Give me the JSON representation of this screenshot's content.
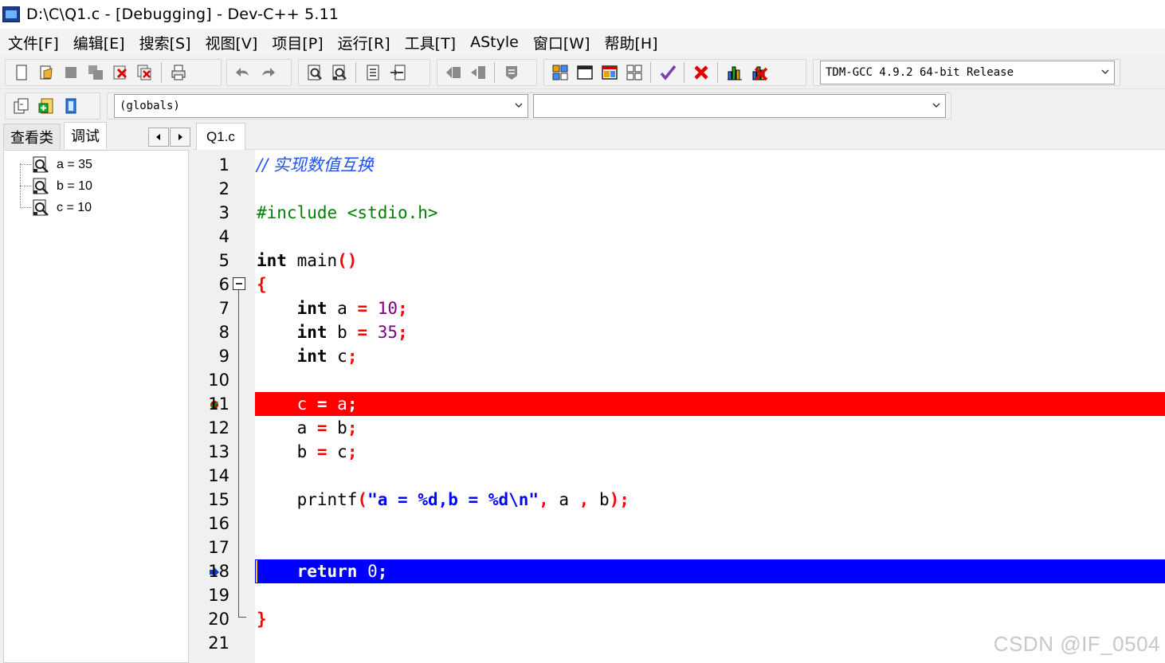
{
  "window": {
    "title": "D:\\C\\Q1.c - [Debugging] - Dev-C++ 5.11"
  },
  "menu": [
    "文件[F]",
    "编辑[E]",
    "搜索[S]",
    "视图[V]",
    "项目[P]",
    "运行[R]",
    "工具[T]",
    "AStyle",
    "窗口[W]",
    "帮助[H]"
  ],
  "compiler_select": {
    "value": "TDM-GCC 4.9.2 64-bit Release"
  },
  "scope_select": {
    "value": "(globals)"
  },
  "function_select": {
    "value": ""
  },
  "left_panel": {
    "tabs": [
      "查看类",
      "调试"
    ],
    "active_tab": "调试",
    "watches": [
      "a = 35",
      "b = 10",
      "c = 10"
    ]
  },
  "editor": {
    "tab": "Q1.c",
    "line_numbers": [
      "1",
      "2",
      "3",
      "4",
      "5",
      "6",
      "7",
      "8",
      "9",
      "10",
      "11",
      "12",
      "13",
      "14",
      "15",
      "16",
      "17",
      "18",
      "19",
      "20",
      "21"
    ],
    "code": {
      "l1": "// 实现数值互换",
      "l3_pre": "#include <stdio.h>",
      "l5_kw": "int",
      "l5_id": " main",
      "l5_sym": "()",
      "l6_sym": "{",
      "l7_kw": "int",
      "l7_id": " a ",
      "l7_op": "=",
      "l7_num": " 10",
      "l7_end": ";",
      "l8_kw": "int",
      "l8_id": " b ",
      "l8_op": "=",
      "l8_num": " 35",
      "l8_end": ";",
      "l9_kw": "int",
      "l9_id": " c",
      "l9_end": ";",
      "l11_a": "c ",
      "l11_op": "=",
      "l11_b": " a",
      "l11_end": ";",
      "l12_a": "a ",
      "l12_op": "=",
      "l12_b": " b",
      "l12_end": ";",
      "l13_a": "b ",
      "l13_op": "=",
      "l13_b": " c",
      "l13_end": ";",
      "l15_fn": "printf",
      "l15_p1": "(",
      "l15_str1": "\"a ",
      "l15_eq1": "=",
      "l15_str2": " %d,b ",
      "l15_eq2": "=",
      "l15_str3": " %d\\n\"",
      "l15_comma1": ",",
      "l15_a": " a ",
      "l15_comma2": ",",
      "l15_b": " b",
      "l15_end": ");",
      "l18_kw": "return",
      "l18_num": " 0",
      "l18_end": ";",
      "l20_sym": "}"
    },
    "breakpoint_line": "11",
    "current_exec_line": "18",
    "colors": {
      "breakpoint": "#ff0000",
      "exec": "#0000ff"
    }
  },
  "watermark": "CSDN @IF_0504"
}
